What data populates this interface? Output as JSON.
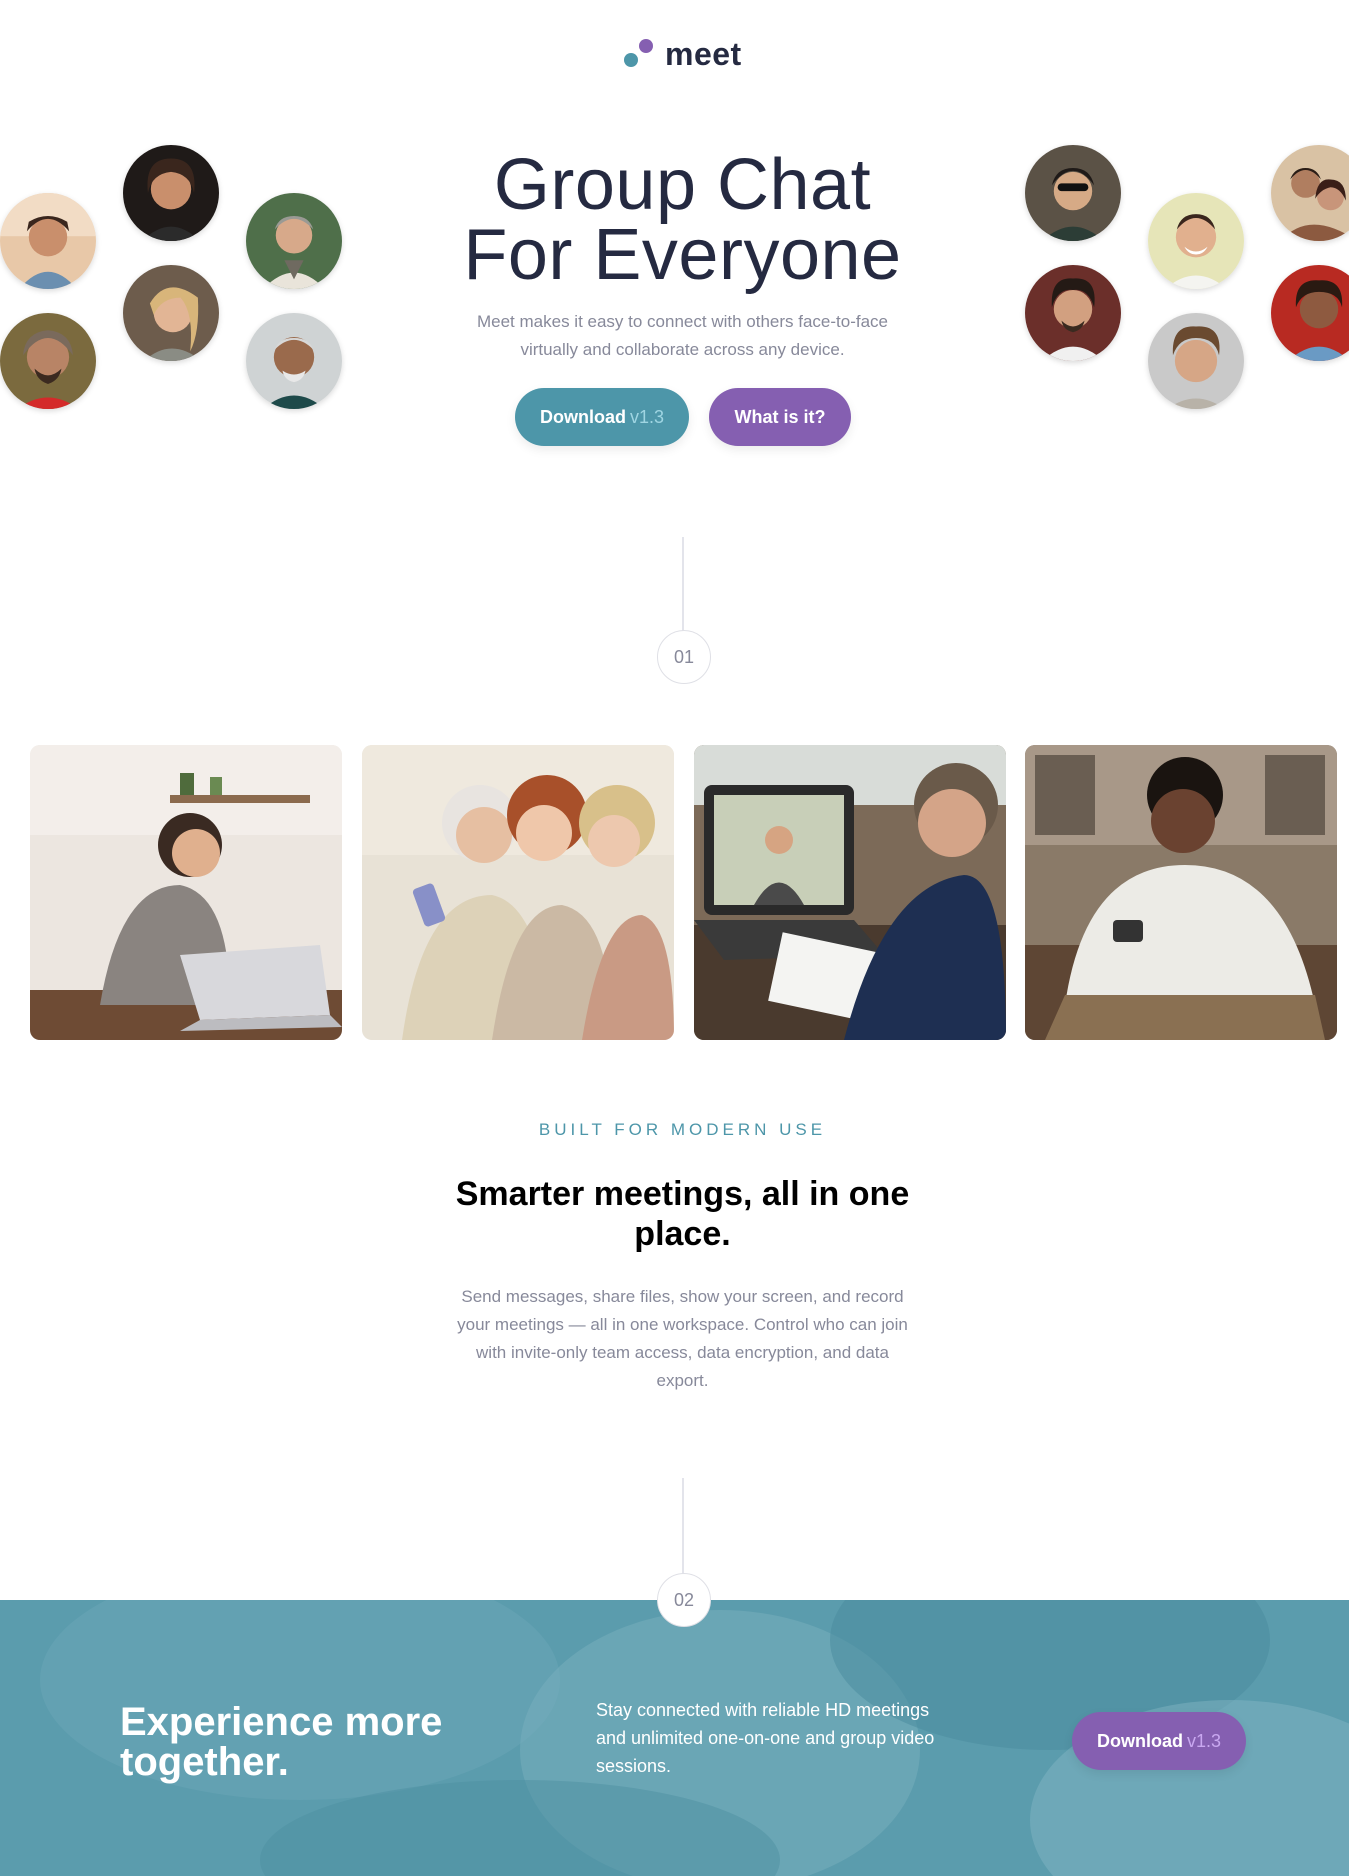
{
  "brand": {
    "logo_text": "meet"
  },
  "colors": {
    "teal": "#4d96a9",
    "purple": "#855fb1",
    "navy": "#252a41",
    "grey": "#87899a"
  },
  "hero": {
    "title_line1": "Group Chat",
    "title_line2": "For Everyone",
    "subtitle": "Meet makes it easy to connect with others face-to-face virtually and collaborate across any device.",
    "primary_button": {
      "label": "Download",
      "version": "v1.3"
    },
    "secondary_button": {
      "label": "What is it?"
    }
  },
  "steps": {
    "first": "01",
    "second": "02"
  },
  "features": {
    "eyebrow": "BUILT FOR MODERN USE",
    "title": "Smarter meetings, all in one place.",
    "body": "Send messages, share files, show your screen, and record your meetings — all in one workspace. Control who can join with invite-only team access, data encryption, and data export."
  },
  "cta": {
    "title": "Experience more together.",
    "text": "Stay connected with reliable HD meetings and unlimited one-on-one and group video sessions.",
    "button": {
      "label": "Download",
      "version": "v1.3"
    }
  }
}
